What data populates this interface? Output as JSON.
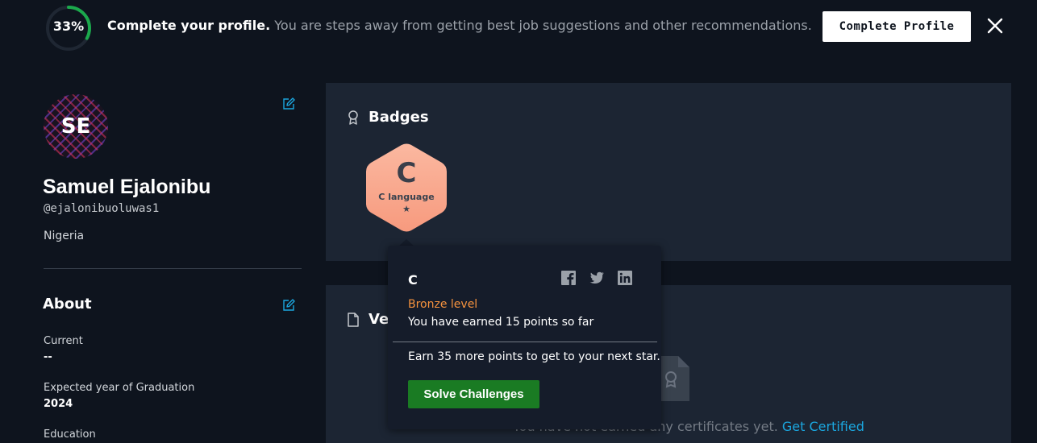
{
  "banner": {
    "progress_label": "33%",
    "progress_fraction": 0.33,
    "title": "Complete your profile.",
    "subtitle": "You are steps away from getting best job suggestions and other recommendations.",
    "button_label": "Complete Profile",
    "close_icon": "close-icon",
    "progress_color": "#1ba94c"
  },
  "profile": {
    "initials": "SE",
    "name": "Samuel Ejalonibu",
    "username": "@ejalonibuoluwas1",
    "country": "Nigeria",
    "edit_icon": "edit-icon"
  },
  "about": {
    "title": "About",
    "current_label": "Current",
    "current_value": "--",
    "graduation_label": "Expected year of Graduation",
    "graduation_value": "2024",
    "education_label": "Education"
  },
  "badges": {
    "title": "Badges",
    "icon": "award-icon",
    "items": [
      {
        "letter": "C",
        "name": "C language",
        "stars": "★",
        "color": "#f9a38a"
      }
    ]
  },
  "tooltip": {
    "title": "C",
    "level": "Bronze level",
    "points": "You have earned 15 points so far",
    "next": "Earn 35 more points to get to your next star.",
    "button_label": "Solve Challenges",
    "share_icons": [
      "facebook-icon",
      "twitter-icon",
      "linkedin-icon"
    ]
  },
  "certificates": {
    "title": "Ver",
    "icon": "document-icon",
    "empty_text": "You have not earned any certificates yet.",
    "link_label": "Get Certified"
  }
}
